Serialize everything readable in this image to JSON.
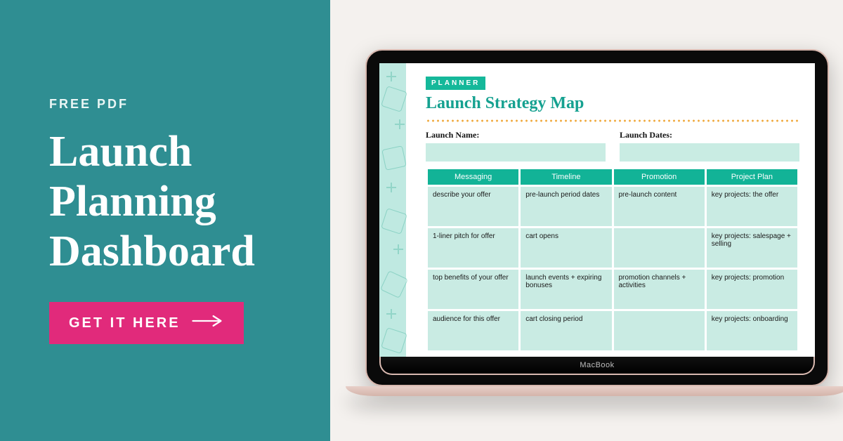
{
  "promo": {
    "kicker": "FREE PDF",
    "headline": "Launch Planning Dashboard",
    "cta_label": "GET IT HERE"
  },
  "device": {
    "brand": "MacBook"
  },
  "planner": {
    "tag": "PLANNER",
    "title": "Launch Strategy Map",
    "meta": {
      "name_label": "Launch Name:",
      "dates_label": "Launch Dates:"
    },
    "columns": [
      "Messaging",
      "Timeline",
      "Promotion",
      "Project Plan"
    ],
    "rows": [
      {
        "messaging": "describe your offer",
        "timeline": "pre-launch period dates",
        "promotion": "pre-launch content",
        "project": "key projects: the offer"
      },
      {
        "messaging": "1-liner pitch for offer",
        "timeline": "cart opens",
        "promotion": "",
        "project": "key projects: salespage + selling"
      },
      {
        "messaging": "top benefits of your offer",
        "timeline": "launch events + expiring bonuses",
        "promotion": "promotion channels + activities",
        "project": "key projects: promotion"
      },
      {
        "messaging": "audience for this offer",
        "timeline": "cart closing period",
        "promotion": "",
        "project": "key projects: onboarding"
      }
    ]
  }
}
